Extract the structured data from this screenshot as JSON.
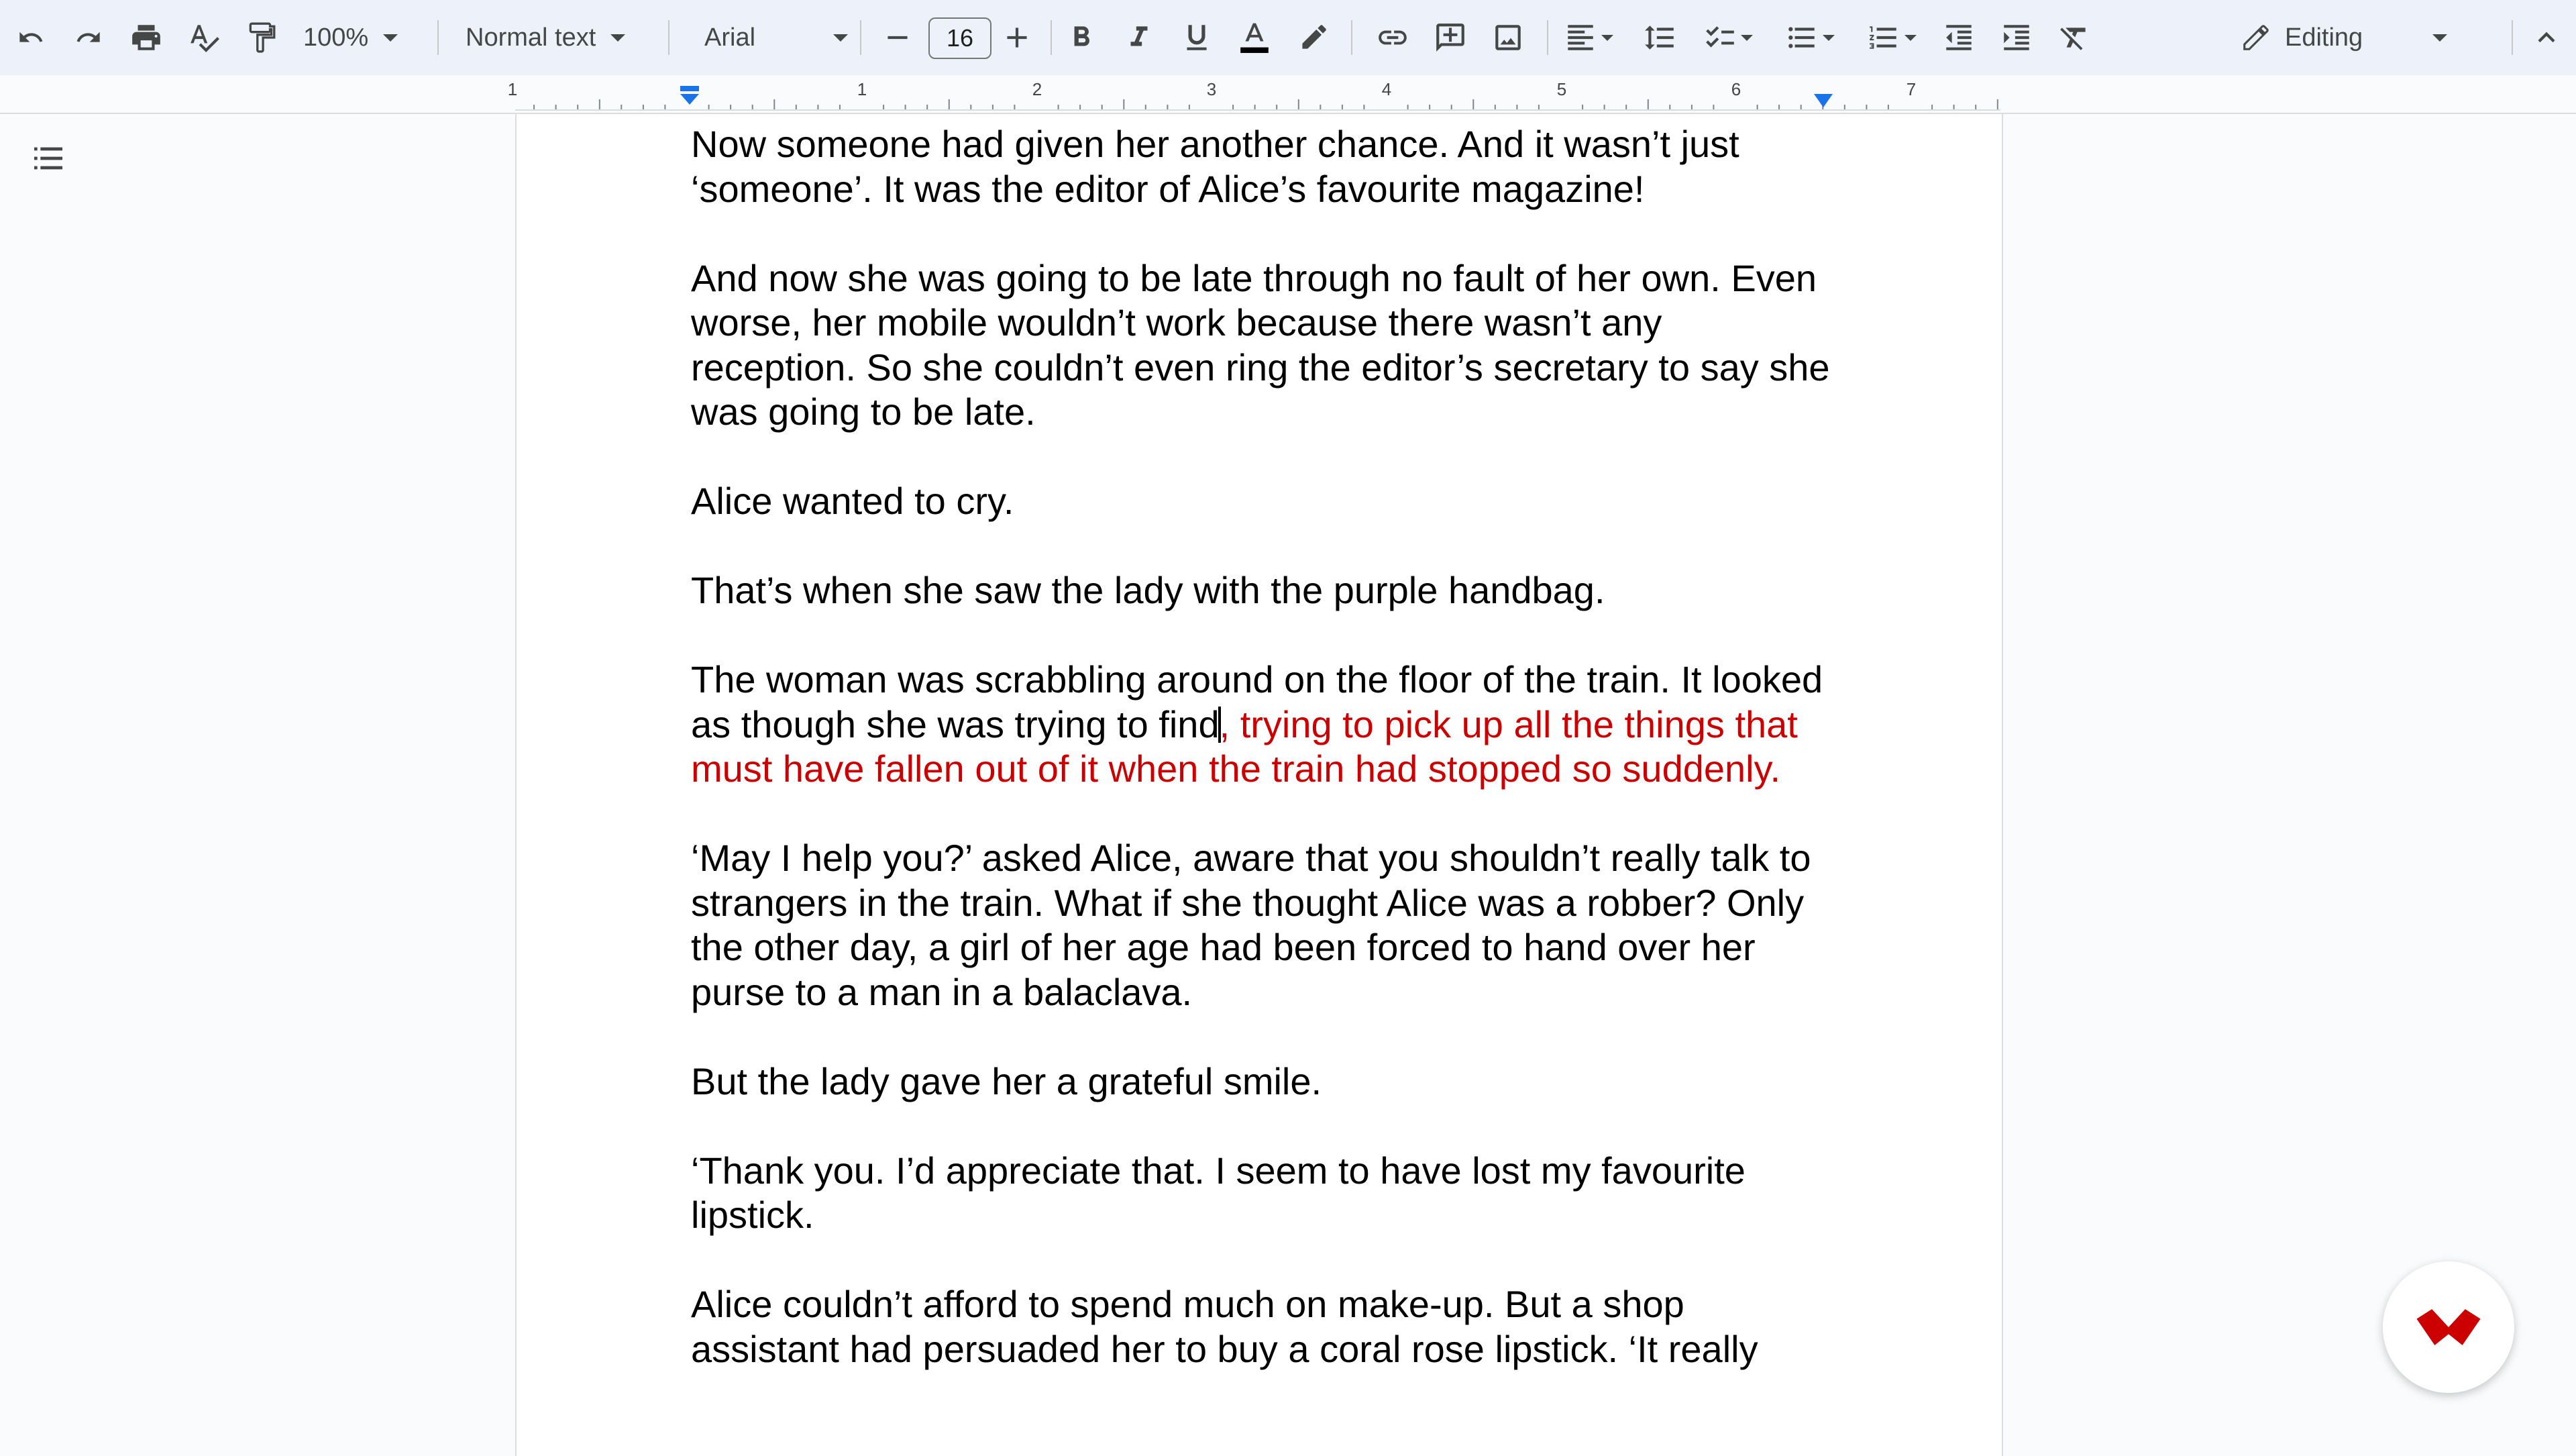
{
  "toolbar": {
    "zoom": "100%",
    "style": "Normal text",
    "font": "Arial",
    "font_size": "16",
    "mode": "Editing"
  },
  "ruler": {
    "numbers": [
      "1",
      "1",
      "2",
      "3",
      "4",
      "5",
      "6",
      "7"
    ]
  },
  "document": {
    "p1": "Now someone had given her another chance. And it wasn’t just ‘someone’. It was the editor of Alice’s favourite magazine!",
    "p2": "And now she was going to be late through no fault of her own. Even worse, her mobile wouldn’t work because there wasn’t any reception. So she couldn’t even ring the editor’s secretary to say she was going to be late.",
    "p3": "Alice wanted to cry.",
    "p4": "That’s when she saw the lady with the purple handbag.",
    "p5_black": "The woman was scrabbling around on the floor of the train. It looked as though she was trying to find",
    "p5_red": ", trying to pick up all the things that must have fallen out of it when the train had stopped so suddenly.",
    "p6": "‘May I help you?’ asked Alice, aware that you shouldn’t really talk to strangers in the train. What if she thought Alice was a robber? Only the other day, a girl of her age had been forced to hand over her purse to a man in a balaclava.",
    "p7": "But the lady gave her a grateful smile.",
    "p8": "‘Thank you. I’d appreciate that. I seem to have lost my favourite lipstick.",
    "p9": "Alice couldn’t afford to spend much on make-up. But a shop assistant had persuaded her to buy a coral rose lipstick. ‘It really"
  },
  "colors": {
    "accent_text": "#cc0000",
    "toolbar_bg": "#edf2fa",
    "ruler_marker": "#1a73e8",
    "logo": "#cc0000"
  },
  "icons": [
    "undo-icon",
    "redo-icon",
    "print-icon",
    "spellcheck-icon",
    "paint-format-icon",
    "bold-icon",
    "italic-icon",
    "underline-icon",
    "text-color-icon",
    "highlight-icon",
    "link-icon",
    "comment-icon",
    "image-icon",
    "align-icon",
    "line-spacing-icon",
    "checklist-icon",
    "bulleted-list-icon",
    "numbered-list-icon",
    "decrease-indent-icon",
    "increase-indent-icon",
    "clear-formatting-icon",
    "pencil-icon",
    "collapse-icon",
    "outline-icon",
    "logo-icon"
  ]
}
